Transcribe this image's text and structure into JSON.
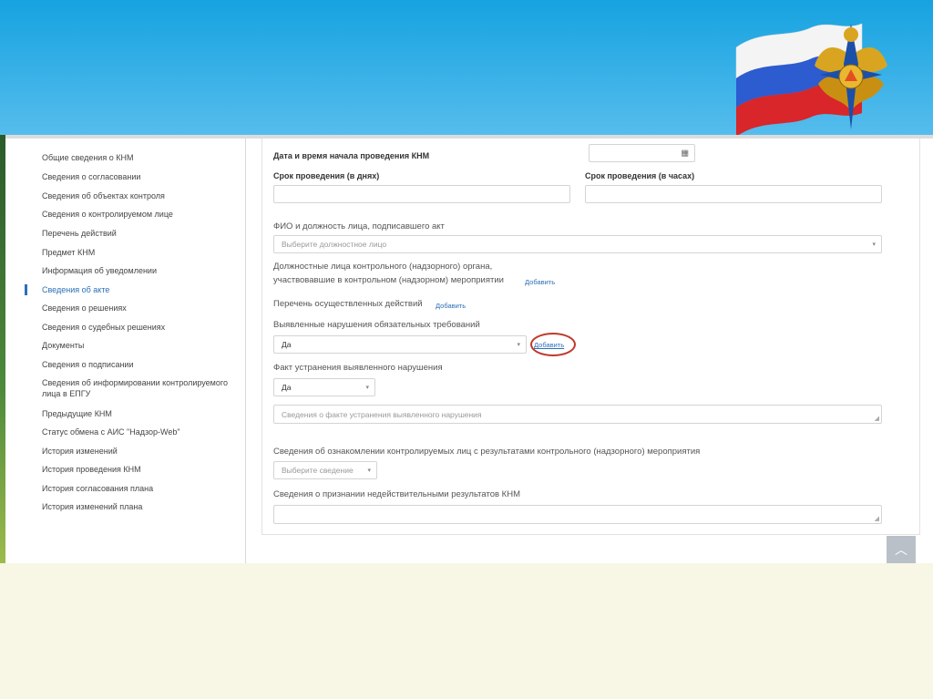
{
  "sidebar": {
    "items": [
      {
        "label": "Общие сведения о КНМ"
      },
      {
        "label": "Сведения о согласовании"
      },
      {
        "label": "Сведения об объектах контроля"
      },
      {
        "label": "Сведения о контролируемом лице"
      },
      {
        "label": "Перечень действий"
      },
      {
        "label": "Предмет КНМ"
      },
      {
        "label": "Информация об уведомлении"
      },
      {
        "label": "Сведения об акте",
        "active": true
      },
      {
        "label": "Сведения о решениях"
      },
      {
        "label": "Сведения о судебных решениях"
      },
      {
        "label": "Документы"
      },
      {
        "label": "Сведения о подписании"
      },
      {
        "label": "Сведения об информировании контролируемого лица в ЕПГУ"
      },
      {
        "label": "Предыдущие КНМ"
      },
      {
        "label": "Статус обмена с АИС \"Надзор-Web\""
      },
      {
        "label": "История изменений"
      },
      {
        "label": "История проведения КНМ"
      },
      {
        "label": "История согласования плана"
      },
      {
        "label": "История изменений плана"
      }
    ]
  },
  "form": {
    "start_datetime_label": "Дата и время начала проведения КНМ",
    "duration_days_label": "Срок проведения (в днях)",
    "duration_hours_label": "Срок проведения (в часах)",
    "signer_label": "ФИО и должность лица, подписавшего акт",
    "signer_placeholder": "Выберите должностное лицо",
    "officials_label_line1": "Должностные лица контрольного (надзорного) органа,",
    "officials_label_line2": "участвовавшие в контрольном (надзорном) мероприятии",
    "officials_add": "Добавить",
    "actions_label": "Перечень осуществленных действий",
    "actions_add": "Добавить",
    "violations_label": "Выявленные нарушения обязательных требований",
    "violations_value": "Да",
    "violations_add": "Добавить",
    "elimination_label": "Факт устранения выявленного нарушения",
    "elimination_value": "Да",
    "elimination_placeholder": "Сведения о факте устранения выявленного нарушения",
    "familiarization_label": "Сведения об ознакомлении контролируемых лиц с результатами контрольного (надзорного) мероприятия",
    "familiarization_placeholder": "Выберите сведение",
    "invalid_label": "Сведения о признании недействительными результатов КНМ"
  },
  "icons": {
    "calendar": "calendar-icon",
    "dropdown": "chevron-down-icon",
    "scroll_top": "chevron-up-icon"
  },
  "colors": {
    "banner": "#1ca6e4",
    "link": "#2c6fb7",
    "highlight_circle": "#c0392b"
  }
}
